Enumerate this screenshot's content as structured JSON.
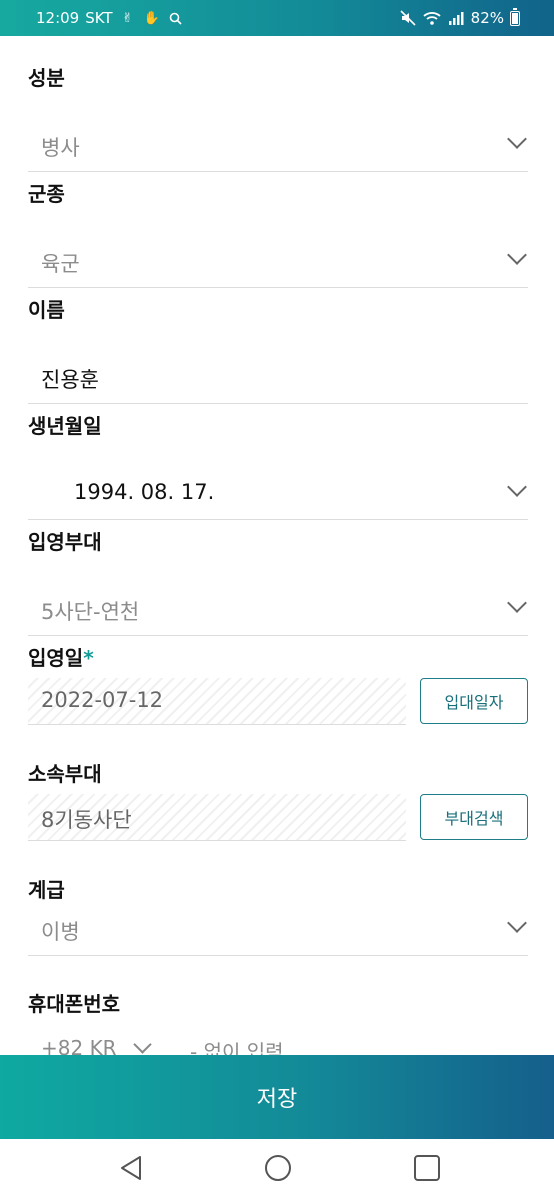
{
  "status_bar": {
    "time": "12:09",
    "carrier": "SKT",
    "battery": "82%",
    "icons": [
      "peace-icon",
      "hand-icon",
      "search-icon",
      "mute-icon",
      "wifi-icon",
      "signal-icon",
      "battery-icon"
    ]
  },
  "form": {
    "rank_class": {
      "label": "성분",
      "value": "병사"
    },
    "branch": {
      "label": "군종",
      "value": "육군"
    },
    "name": {
      "label": "이름",
      "value": "진용훈"
    },
    "birthdate": {
      "label": "생년월일",
      "value": "1994. 08. 17."
    },
    "enlist_unit": {
      "label": "입영부대",
      "value": "5사단-연천"
    },
    "enlist_date": {
      "label": "입영일",
      "required_mark": "*",
      "value": "2022-07-12",
      "button": "입대일자"
    },
    "affiliated_unit": {
      "label": "소속부대",
      "value": "8기동사단",
      "button": "부대검색"
    },
    "grade": {
      "label": "계급",
      "value": "이병"
    },
    "phone": {
      "label": "휴대폰번호",
      "country_code": "+82 KR",
      "placeholder": "- 없이 입력"
    }
  },
  "save_button": {
    "label": "저장"
  },
  "colors": {
    "accent": "#129a96",
    "gradient_start": "#0fa9a1",
    "gradient_end": "#155f8c",
    "button_border": "#1e7d87"
  }
}
